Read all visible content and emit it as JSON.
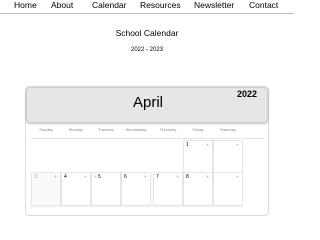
{
  "nav": {
    "items": [
      {
        "label": "Home"
      },
      {
        "label": "About"
      },
      {
        "label": "Calendar"
      },
      {
        "label": "Resources"
      },
      {
        "label": "Newsletter"
      },
      {
        "label": "Contact"
      }
    ]
  },
  "page": {
    "title": "School Calendar",
    "subtitle": "2022 - 2023"
  },
  "calendar": {
    "month": "April",
    "year": "2022",
    "weekdays": [
      "Sunday",
      "Monday",
      "Tuesday",
      "Wednesday",
      "Thursday",
      "Friday",
      "Saturday"
    ],
    "week1": {
      "friday": {
        "num": "1",
        "add": "+"
      },
      "saturday": {
        "add": "+"
      }
    },
    "week2": [
      {
        "num": "3",
        "add": "+"
      },
      {
        "num": "4",
        "add": "+"
      },
      {
        "num": "5",
        "add": "+"
      },
      {
        "num": "6",
        "add": "+"
      },
      {
        "num": "7",
        "add": "+"
      },
      {
        "num": "8",
        "add": "+"
      },
      {
        "add": "+"
      }
    ]
  }
}
